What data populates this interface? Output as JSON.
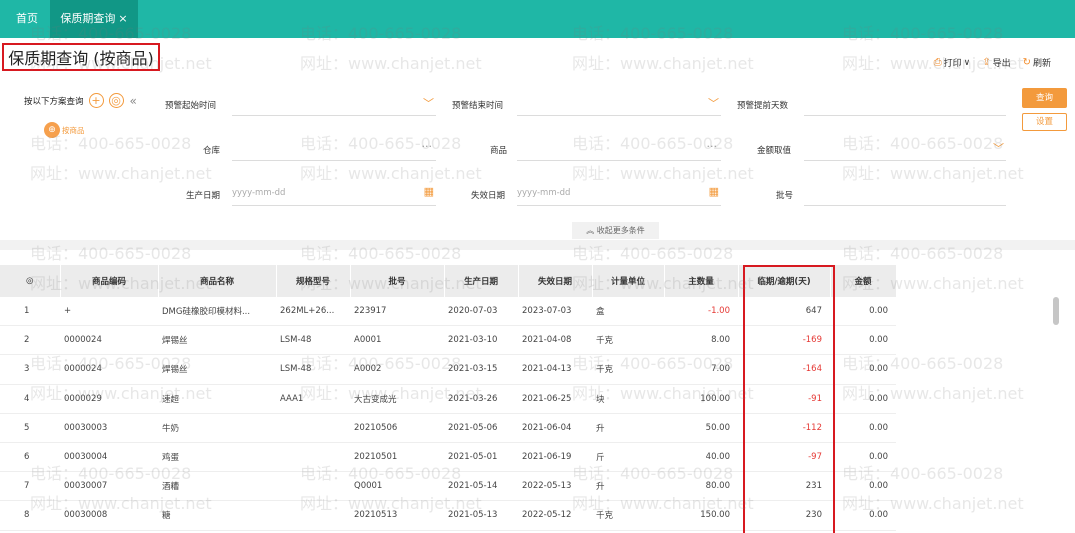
{
  "tabs": {
    "home": "首页",
    "active": "保质期查询",
    "close": "×"
  },
  "page_title": "保质期查询 (按商品)",
  "toolbar": {
    "print": "打印",
    "export": "导出",
    "refresh": "刷新"
  },
  "filter": {
    "scheme_label": "按以下方案查询",
    "scheme_name": "按商品",
    "scheme_icon_text": "⊕",
    "warn_start_label": "预警起始时间",
    "warn_end_label": "预警结束时间",
    "warn_days_label": "预警提前天数",
    "warehouse_label": "仓库",
    "goods_label": "商品",
    "amount_label": "金额取值",
    "prod_date_label": "生产日期",
    "expiry_date_label": "失效日期",
    "batch_label": "批号",
    "date_placeholder": "yyyy-mm-dd",
    "query_btn": "查询",
    "settings_btn": "设置",
    "more_conditions": "收起更多条件"
  },
  "table": {
    "columns": [
      "◎",
      "商品编码",
      "商品名称",
      "规格型号",
      "批号",
      "生产日期",
      "失效日期",
      "计量单位",
      "主数量",
      "临期/逾期(天)",
      "金额"
    ],
    "rows": [
      [
        "1",
        "+",
        "DMG硅橡胶印模材料...",
        "262ML+26...",
        "223917",
        "2020-07-03",
        "2023-07-03",
        "盒",
        "-1.00",
        "647",
        "0.00"
      ],
      [
        "2",
        "0000024",
        "焊锡丝",
        "LSM-48",
        "A0001",
        "2021-03-10",
        "2021-04-08",
        "千克",
        "8.00",
        "-169",
        "0.00"
      ],
      [
        "3",
        "0000024",
        "焊锡丝",
        "LSM-48",
        "A0002",
        "2021-03-15",
        "2021-04-13",
        "千克",
        "7.00",
        "-164",
        "0.00"
      ],
      [
        "4",
        "0000029",
        "速超",
        "AAA1",
        "大古变成光",
        "2021-03-26",
        "2021-06-25",
        "块",
        "100.00",
        "-91",
        "0.00"
      ],
      [
        "5",
        "00030003",
        "牛奶",
        "",
        "20210506",
        "2021-05-06",
        "2021-06-04",
        "升",
        "50.00",
        "-112",
        "0.00"
      ],
      [
        "6",
        "00030004",
        "鸡蛋",
        "",
        "20210501",
        "2021-05-01",
        "2021-06-19",
        "斤",
        "40.00",
        "-97",
        "0.00"
      ],
      [
        "7",
        "00030007",
        "酒糟",
        "",
        "Q0001",
        "2021-05-14",
        "2022-05-13",
        "升",
        "80.00",
        "231",
        "0.00"
      ],
      [
        "8",
        "00030008",
        "糖",
        "",
        "20210513",
        "2021-05-13",
        "2022-05-12",
        "千克",
        "150.00",
        "230",
        "0.00"
      ]
    ]
  },
  "watermark": {
    "phone": "电话：400-665-0028",
    "site": "网址：www.chanjet.net"
  },
  "colors": {
    "teal": "#1fb7a6",
    "accent": "#f39a3c",
    "highlight": "#d71920",
    "negative": "#e53935"
  }
}
